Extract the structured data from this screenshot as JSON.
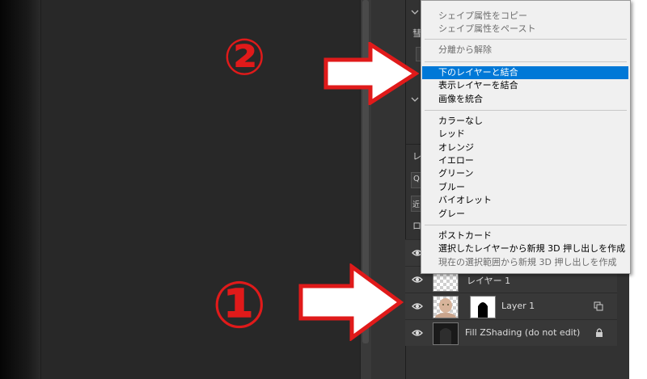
{
  "colors": {
    "annotation": "#e01a1a",
    "highlight": "#0078d7",
    "menu_bg": "#f0f0f0",
    "panel_bg": "#323232"
  },
  "panel": {
    "peek_chars": [
      "彗",
      "レ",
      "ロ"
    ],
    "peek_sym": [
      "Q",
      "近"
    ]
  },
  "menu": {
    "group1": [
      "シェイプ属性をコピー",
      "シェイプ属性をペースト"
    ],
    "group2": [
      "分離から解除"
    ],
    "group3": [
      "下のレイヤーと結合",
      "表示レイヤーを結合",
      "画像を統合"
    ],
    "group4": [
      "カラーなし",
      "レッド",
      "オレンジ",
      "イエロー",
      "グリーン",
      "ブルー",
      "バイオレット",
      "グレー"
    ],
    "group5": [
      "ポストカード",
      "選択したレイヤーから新規 3D 押し出しを作成",
      "現在の選択範囲から新規 3D 押し出しを作成"
    ]
  },
  "layers": [
    {
      "name": "",
      "icon": "eye-icon"
    },
    {
      "name": "レイヤー 1",
      "icon": "eye-icon"
    },
    {
      "name": "Layer 1",
      "icon": "eye-icon"
    },
    {
      "name": "Fill ZShading (do not edit)",
      "icon": "eye-icon"
    }
  ],
  "annotations": {
    "step1": "①",
    "step2": "②"
  }
}
